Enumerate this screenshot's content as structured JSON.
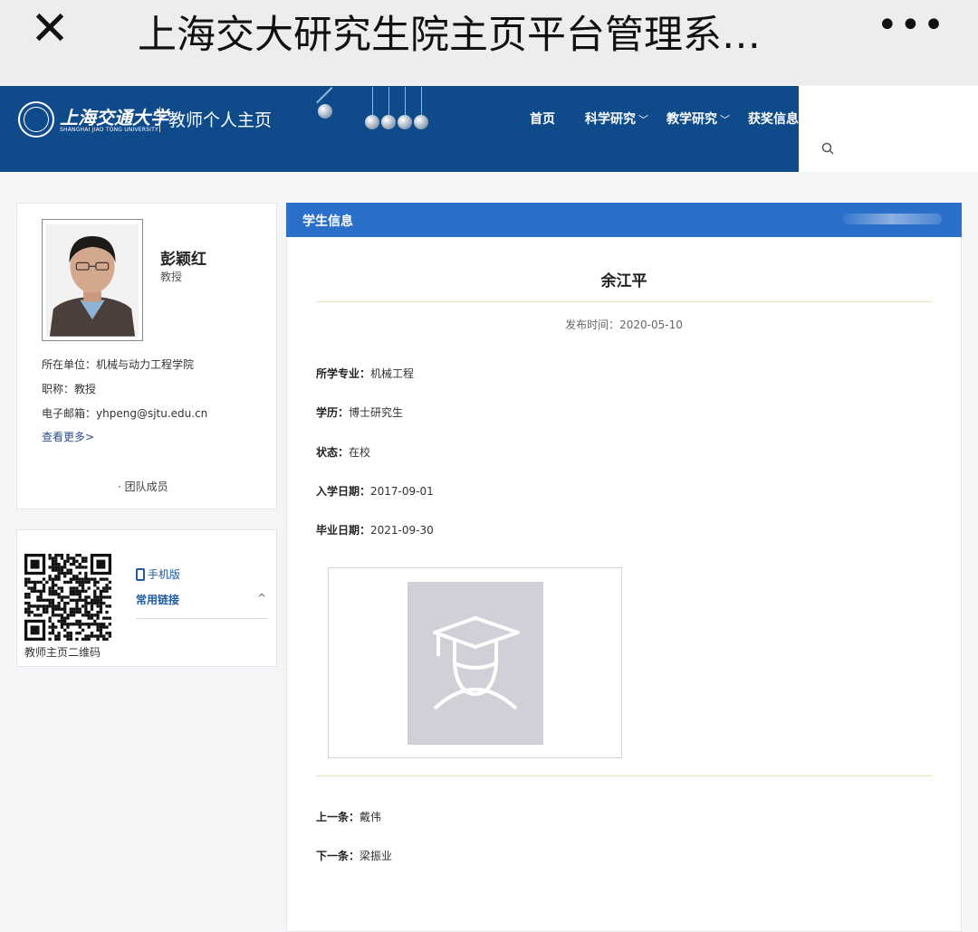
{
  "wechat_bar": {
    "close_glyph": "✕",
    "title": "上海交大研究生院主页平台管理系…",
    "more_glyph": "•••"
  },
  "header": {
    "logo_cn": "上海交通大学",
    "logo_en": "SHANGHAI JIAO TONG UNIVERSITY",
    "logo_subtitle": "教师个人主页",
    "nav": [
      {
        "label": "首页",
        "has_dropdown": false
      },
      {
        "label": "科学研究",
        "has_dropdown": true
      },
      {
        "label": "教学研究",
        "has_dropdown": true
      },
      {
        "label": "获奖信息",
        "has_dropdown": false
      }
    ],
    "search_icon": "search-icon",
    "brand_color": "#0f4a8a"
  },
  "profile": {
    "name": "彭颖红",
    "title": "教授",
    "unit_label": "所在单位：",
    "unit": "机械与动力工程学院",
    "rank_label": "职称：",
    "rank": "教授",
    "email_label": "电子邮箱：",
    "email": "yhpeng@sjtu.edu.cn",
    "more_link": "查看更多>",
    "team_link": "· 团队成员"
  },
  "qr_card": {
    "qr_label": "教师主页二维码",
    "mobile_label": "手机版",
    "links_label": "常用链接",
    "links_caret": "^"
  },
  "student": {
    "section_title": "学生信息",
    "name": "余江平",
    "publish_label": "发布时间：",
    "publish_date": "2020-05-10",
    "fields": [
      {
        "label": "所学专业：",
        "value": "机械工程"
      },
      {
        "label": "学历：",
        "value": "博士研究生"
      },
      {
        "label": "状态：",
        "value": "在校"
      },
      {
        "label": "入学日期：",
        "value": "2017-09-01"
      },
      {
        "label": "毕业日期：",
        "value": "2021-09-30"
      }
    ],
    "prev_label": "上一条：",
    "prev_value": "戴伟",
    "next_label": "下一条：",
    "next_value": "梁振业",
    "header_color": "#2a6fc9"
  }
}
